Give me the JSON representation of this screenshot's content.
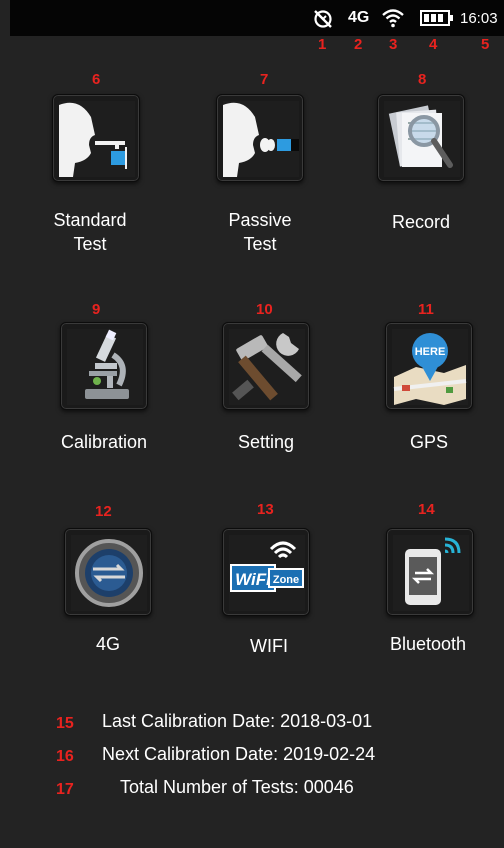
{
  "status_bar": {
    "network": "4G",
    "time": "16:03",
    "icons": [
      "no-alarm-icon",
      "network-4g",
      "wifi-icon",
      "battery-icon"
    ],
    "markers": [
      "1",
      "2",
      "3",
      "4",
      "5"
    ]
  },
  "apps": [
    {
      "num": "6",
      "label_line1": "Standard",
      "label_line2": "Test",
      "icon": "standard-test-icon"
    },
    {
      "num": "7",
      "label_line1": "Passive",
      "label_line2": "Test",
      "icon": "passive-test-icon"
    },
    {
      "num": "8",
      "label_line1": "Record",
      "label_line2": "",
      "icon": "record-icon"
    },
    {
      "num": "9",
      "label_line1": "Calibration",
      "label_line2": "",
      "icon": "microscope-icon"
    },
    {
      "num": "10",
      "label_line1": "Setting",
      "label_line2": "",
      "icon": "tools-icon"
    },
    {
      "num": "11",
      "label_line1": "GPS",
      "label_line2": "",
      "icon": "map-pin-icon",
      "badge": "HERE"
    },
    {
      "num": "12",
      "label_line1": "4G",
      "label_line2": "",
      "icon": "4g-globe-icon"
    },
    {
      "num": "13",
      "label_line1": "WIFI",
      "label_line2": "",
      "icon": "wifi-zone-icon",
      "badge_main": "WiFi",
      "badge_sub": "Zone"
    },
    {
      "num": "14",
      "label_line1": "Bluetooth",
      "label_line2": "",
      "icon": "bluetooth-phone-icon"
    }
  ],
  "info": [
    {
      "num": "15",
      "text": "Last Calibration Date: 2018-03-01"
    },
    {
      "num": "16",
      "text": "Next Calibration Date: 2019-02-24"
    },
    {
      "num": "17",
      "text": "Total Number of Tests: 00046"
    }
  ],
  "colors": {
    "marker": "#e8231f",
    "background": "#232323",
    "status_bar": "#050505"
  }
}
